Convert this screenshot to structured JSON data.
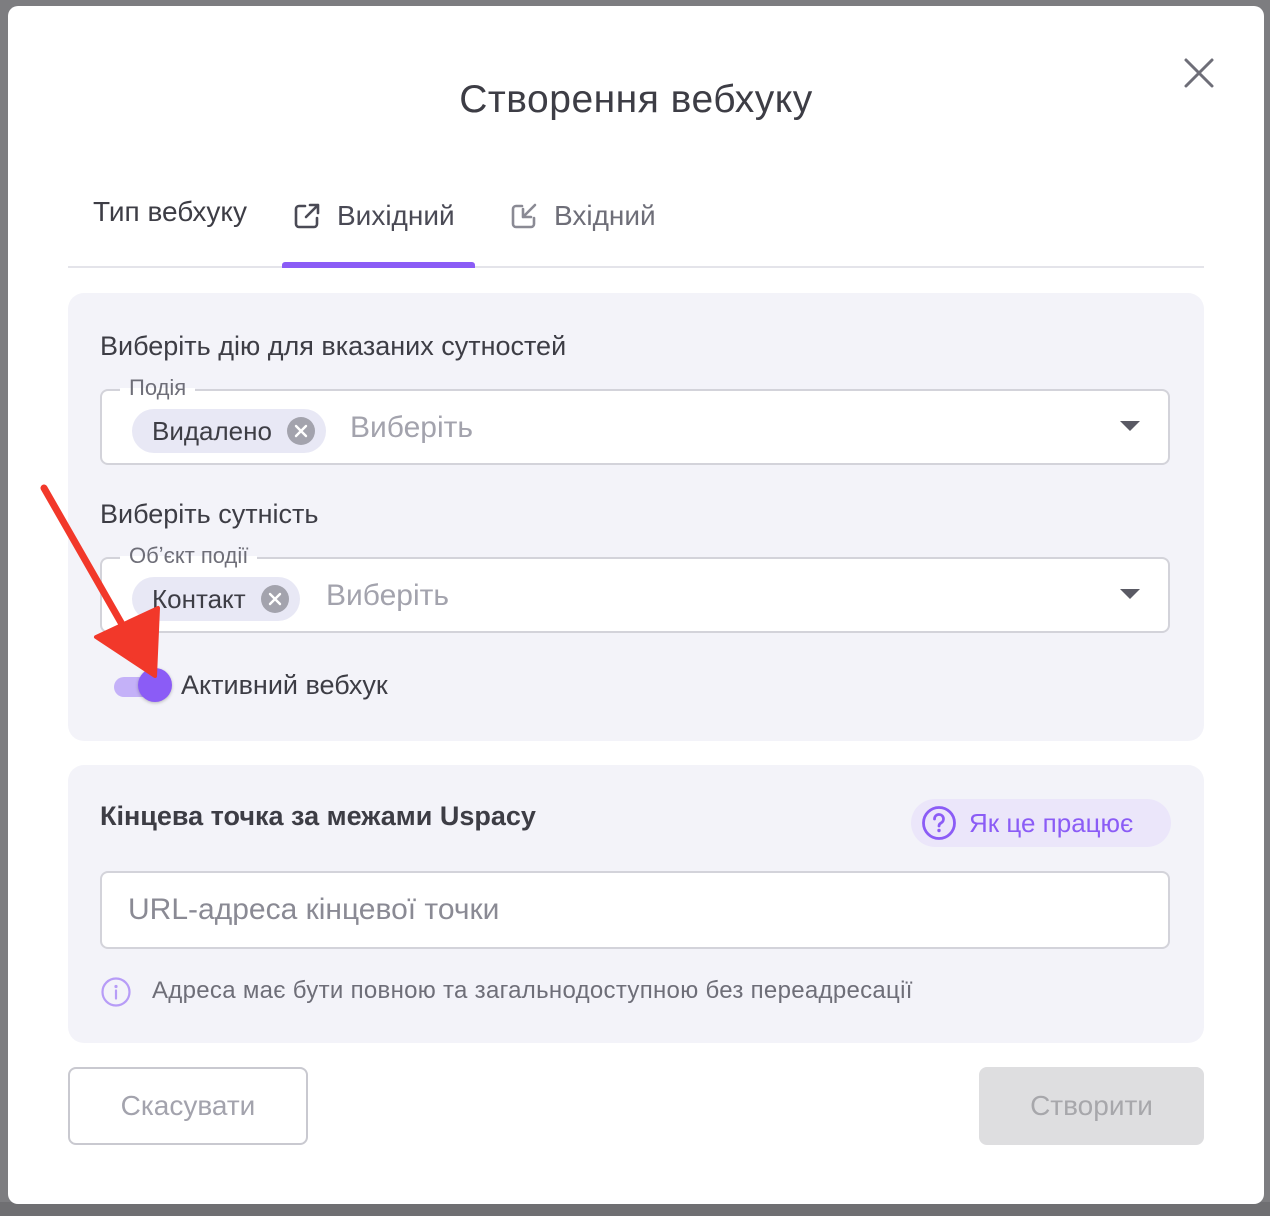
{
  "modal": {
    "title": "Створення вебхуку",
    "close_icon": "close-icon"
  },
  "tabs": {
    "label": "Тип вебхуку",
    "items": [
      {
        "label": "Вихідний",
        "icon": "external-link-icon",
        "active": true
      },
      {
        "label": "Вхідний",
        "icon": "incoming-arrow-icon",
        "active": false
      }
    ]
  },
  "event_section": {
    "label": "Виберіть дію для вказаних сутностей",
    "field": {
      "legend": "Подія",
      "selected_chip": "Видалено",
      "placeholder": "Виберіть"
    }
  },
  "entity_section": {
    "label": "Виберіть сутність",
    "field": {
      "legend": "Обʼєкт події",
      "selected_chip": "Контакт",
      "placeholder": "Виберіть"
    }
  },
  "active_toggle": {
    "label": "Активний вебхук",
    "on": true
  },
  "endpoint_section": {
    "title": "Кінцева точка за межами Uspacy",
    "help_link": "Як це працює",
    "url_placeholder": "URL-адреса кінцевої точки",
    "url_value": "",
    "hint": "Адреса має бути повною та загальнодоступною без переадресації"
  },
  "footer": {
    "cancel_label": "Скасувати",
    "create_label": "Створити"
  },
  "colors": {
    "accent": "#8b5cf6",
    "annotation_arrow": "#f2382a"
  }
}
